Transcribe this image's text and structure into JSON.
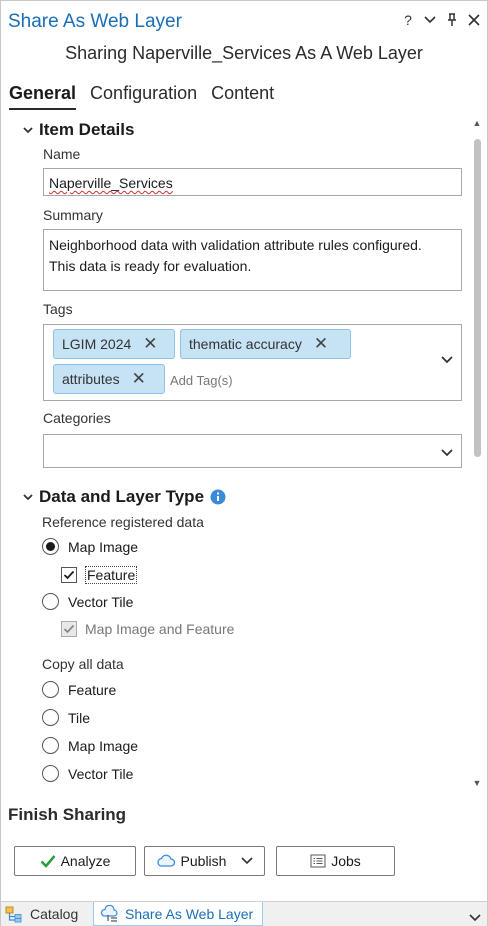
{
  "window": {
    "title": "Share As Web Layer",
    "controls": [
      "?",
      "⌄",
      "⊥",
      "✕"
    ]
  },
  "subtitle": "Sharing Naperville_Services As A Web Layer",
  "tabs": [
    "General",
    "Configuration",
    "Content"
  ],
  "item_details": {
    "heading": "Item Details",
    "name_label": "Name",
    "name_value": "Naperville_Services",
    "summary_label": "Summary",
    "summary_line1": "Neighborhood data with validation attribute rules configured.",
    "summary_line2": "This data is ready for evaluation.",
    "tags_label": "Tags",
    "tags": [
      "LGIM 2024",
      "thematic accuracy",
      "attributes"
    ],
    "tag_placeholder": "Add Tag(s)",
    "categories_label": "Categories",
    "categories_value": ""
  },
  "data_layer_type": {
    "heading": "Data and Layer Type",
    "reference_label": "Reference registered data",
    "reference_options": {
      "map_image": "Map Image",
      "feature": "Feature",
      "vector_tile": "Vector Tile",
      "map_image_and_feature": "Map Image and Feature"
    },
    "copy_label": "Copy all data",
    "copy_options": [
      "Feature",
      "Tile",
      "Map Image",
      "Vector Tile"
    ]
  },
  "finish": {
    "heading": "Finish Sharing",
    "analyze_label": "Analyze",
    "publish_label": "Publish",
    "jobs_label": "Jobs"
  },
  "bottom_tabs": [
    "Catalog",
    "Share As Web Layer"
  ],
  "colors": {
    "accent": "#1a6eb5",
    "tag_bg": "#c6e2f5",
    "info_icon": "#3b8ad9",
    "check_green": "#2e9e3c"
  }
}
